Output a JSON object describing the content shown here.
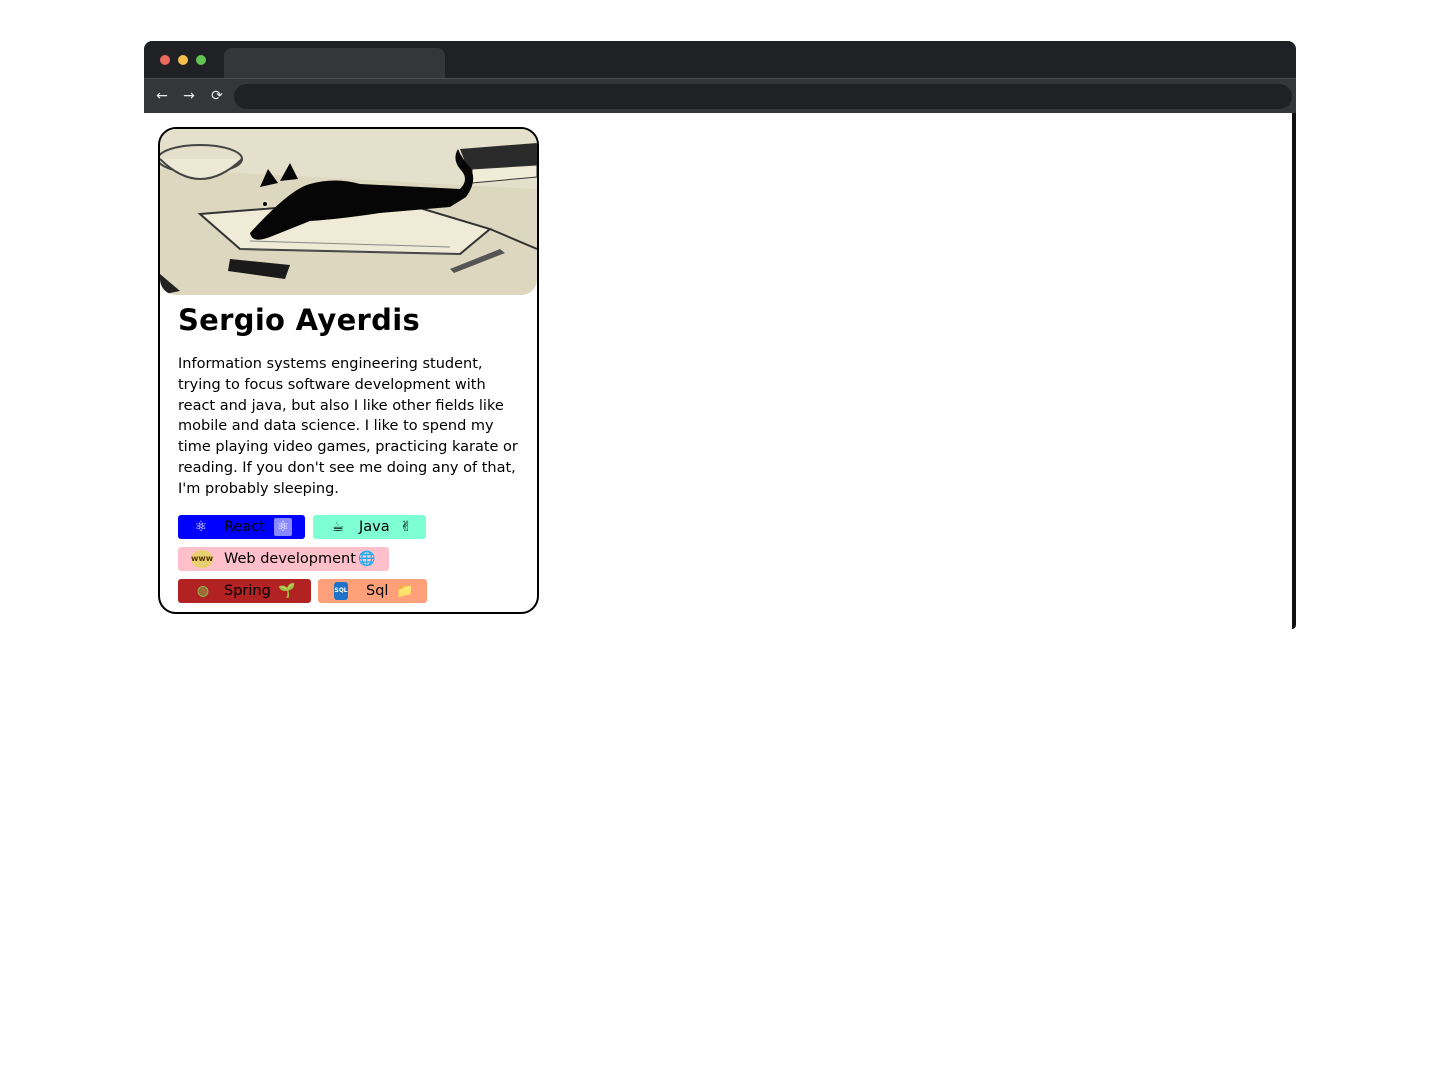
{
  "browser": {
    "tab_title": "",
    "address": "",
    "nav": {
      "back": "←",
      "forward": "→",
      "reload": "⟳"
    }
  },
  "profile": {
    "name": "Sergio Ayerdis",
    "bio": "Information systems engineering student, trying to focus software development with react and java, but also I like other fields like mobile and data science. I like to spend my time playing video games, practicing karate or reading. If you don't see me doing any of that, I'm probably sleeping.",
    "tags": [
      {
        "label": "React",
        "icon_left": "⚛",
        "icon_right": "⚛",
        "color": "#0000ff"
      },
      {
        "label": "Java",
        "icon_left": "☕",
        "icon_right": "✌",
        "color": "#7fffd4"
      },
      {
        "label": "Web development",
        "icon_left": "www",
        "icon_right": "🌐",
        "color": "#ffc0cb"
      },
      {
        "label": "Spring",
        "icon_left": "◍",
        "icon_right": "🌱",
        "color": "#b22222"
      },
      {
        "label": "Sql",
        "icon_left": "SQL",
        "icon_right": "📁",
        "color": "#ffa07a"
      }
    ]
  }
}
